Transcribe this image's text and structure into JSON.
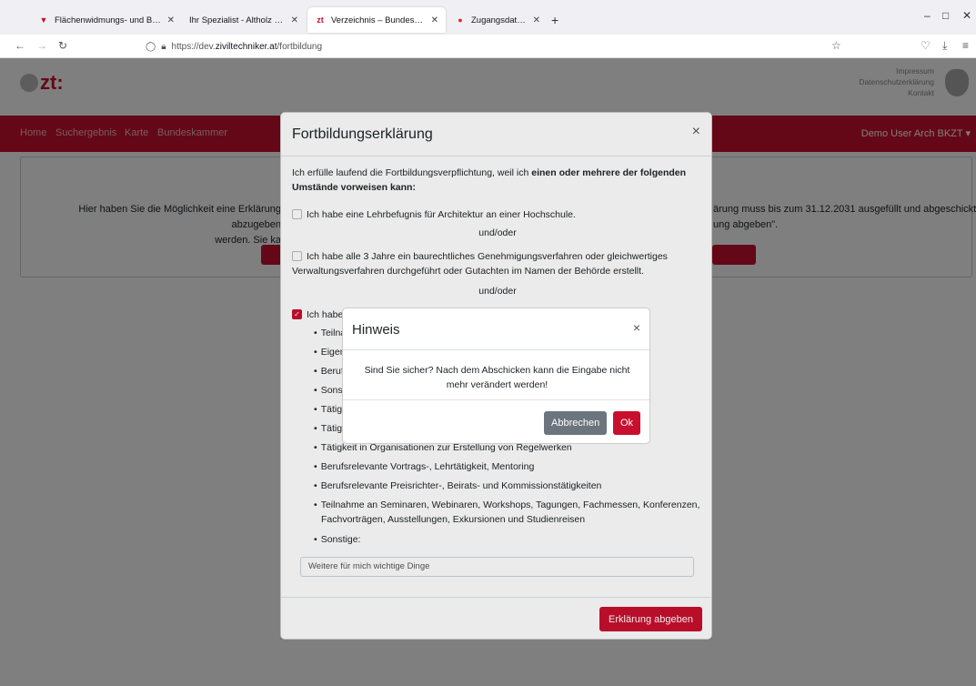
{
  "browser": {
    "tabs": [
      {
        "title": "Flächenwidmungs- und Bebau",
        "fav": "▼"
      },
      {
        "title": "Ihr Spezialist - Altholz und Antiq",
        "fav": ""
      },
      {
        "title": "Verzeichnis – Bundeskammer d",
        "fav": "zt"
      },
      {
        "title": "Zugangsdaten und Passwörter",
        "fav": "●"
      }
    ],
    "url_prefix": "https://dev.",
    "url_host": "ziviltechniker.at",
    "url_path": "/fortbildung"
  },
  "site": {
    "logo": "zt:",
    "header_links": [
      "Impressum",
      "Datenschutzerklärung",
      "Kontakt"
    ],
    "nav": [
      "Home",
      "Suchergebnis",
      "Karte",
      "Bundeskammer"
    ],
    "user": "Demo User Arch BKZT ▾",
    "info_left_line1": "Hier haben Sie die Möglichkeit eine Erklärung abzugeben",
    "info_left_line2": "werden. Sie ka",
    "info_right_line1": "ärung muss bis zum 31.12.2031 ausgefüllt und abgeschickt",
    "info_right_line2": "ung abgeben\"."
  },
  "modal": {
    "title": "Fortbildungserklärung",
    "intro_plain": "Ich erfülle laufend die Fortbildungsverpflichtung, weil ich ",
    "intro_bold1": "einen oder mehrere der folgenden",
    "intro_bold2": "Umstände vorweisen kann:",
    "option1": "Ich habe eine Lehrbefugnis für Architektur an einer Hochschule.",
    "and_or": "und/oder",
    "option2_line1": "Ich habe alle 3 Jahre ein baurechtliches Genehmigungsverfahren oder gleichwertiges",
    "option2_line2": "Verwaltungsverfahren durchgeführt oder Gutachten im Namen der Behörde erstellt.",
    "option3": "Ich habe",
    "list": [
      "Teilnal",
      "Eigene",
      "Berufs",
      "Sonsti",
      "Tätigk",
      "Tätigk",
      "Tätigkeit in Organisationen zur Erstellung von Regelwerken",
      "Berufsrelevante Vortrags-, Lehrtätigkeit, Mentoring",
      "Berufsrelevante Preisrichter-, Beirats- und Kommissionstätigkeiten",
      "Teilnahme an Seminaren, Webinaren, Workshops, Tagungen, Fachmessen, Konferenzen,",
      "Sonstige:"
    ],
    "list_continuation": "Fachvorträgen, Ausstellungen, Exkursionen und Studienreisen",
    "input_placeholder": "Weitere für mich wichtige Dinge",
    "submit": "Erklärung abgeben"
  },
  "confirm": {
    "title": "Hinweis",
    "message_line1": "Sind Sie sicher? Nach dem Abschicken kann die Eingabe nicht",
    "message_line2": "mehr verändert werden!",
    "cancel": "Abbrechen",
    "ok": "Ok"
  }
}
